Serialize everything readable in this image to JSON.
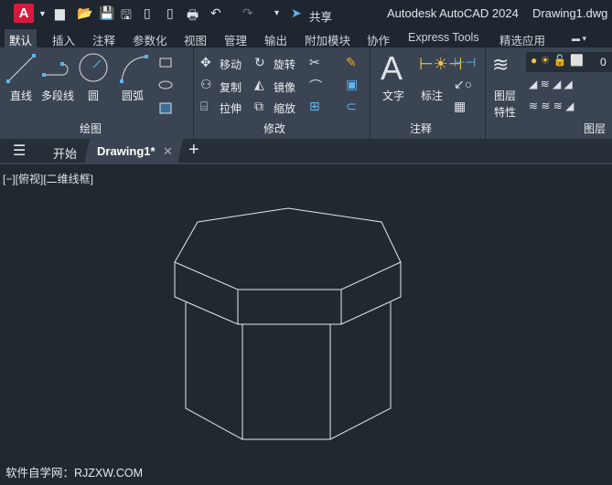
{
  "titlebar": {
    "logo": "A",
    "share": "共享",
    "app_title": "Autodesk AutoCAD 2024",
    "file": "Drawing1.dwg"
  },
  "ribbon_tabs": [
    "默认",
    "插入",
    "注释",
    "参数化",
    "视图",
    "管理",
    "输出",
    "附加模块",
    "协作",
    "Express Tools",
    "精选应用"
  ],
  "draw": {
    "line": "直线",
    "polyline": "多段线",
    "circle": "圆",
    "arc": "圆弧",
    "panel": "绘图"
  },
  "modify": {
    "move": "移动",
    "rotate": "旋转",
    "copy": "复制",
    "mirror": "镜像",
    "stretch": "拉伸",
    "scale": "缩放",
    "panel": "修改"
  },
  "annotation": {
    "text": "文字",
    "dim": "标注",
    "panel": "注释"
  },
  "layers": {
    "props_1": "图层",
    "props_2": "特性",
    "current": "0",
    "panel": "图层"
  },
  "doc_tabs": {
    "start": "开始",
    "drawing": "Drawing1*"
  },
  "viewport_label": "[−][俯视][二维线框]",
  "watermark": "软件自学网：RJZXW.COM"
}
